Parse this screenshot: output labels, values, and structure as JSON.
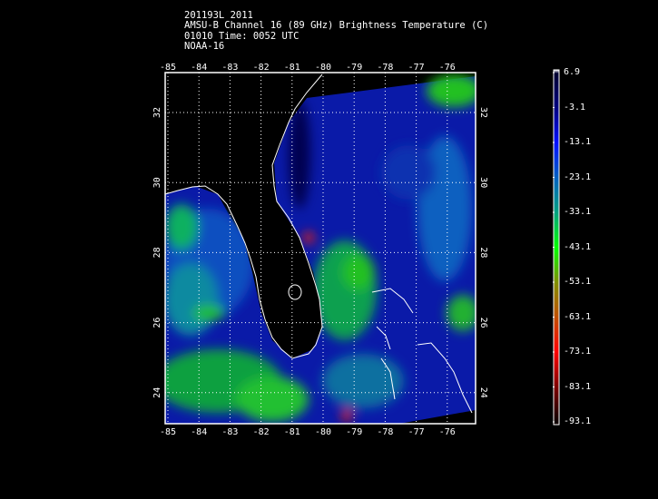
{
  "header": {
    "line1": "201193L 2011",
    "line2": "AMSU-B Channel 16 (89 GHz) Brightness Temperature (C)",
    "line3": "01010 Time: 0052 UTC",
    "line4": "NOAA-16"
  },
  "map": {
    "lon_ticks": [
      "-85",
      "-84",
      "-83",
      "-82",
      "-81",
      "-80",
      "-79",
      "-78",
      "-77",
      "-76"
    ],
    "lat_ticks": [
      "32",
      "30",
      "28",
      "26",
      "24"
    ],
    "lon_range": [
      -85.1,
      -75.1
    ],
    "lat_range": [
      23.1,
      33.1
    ]
  },
  "colorbar": {
    "labels": [
      "6.9",
      "-3.1",
      "-13.1",
      "-23.1",
      "-33.1",
      "-43.1",
      "-53.1",
      "-63.1",
      "-73.1",
      "-83.1",
      "-93.1"
    ],
    "range": [
      -93.1,
      6.9
    ],
    "colors": [
      "#ffffff",
      "#000030",
      "#000080",
      "#0010ff",
      "#0060c0",
      "#00a080",
      "#00ff00",
      "#809000",
      "#c05000",
      "#ff0000",
      "#800000",
      "#100000"
    ]
  }
}
